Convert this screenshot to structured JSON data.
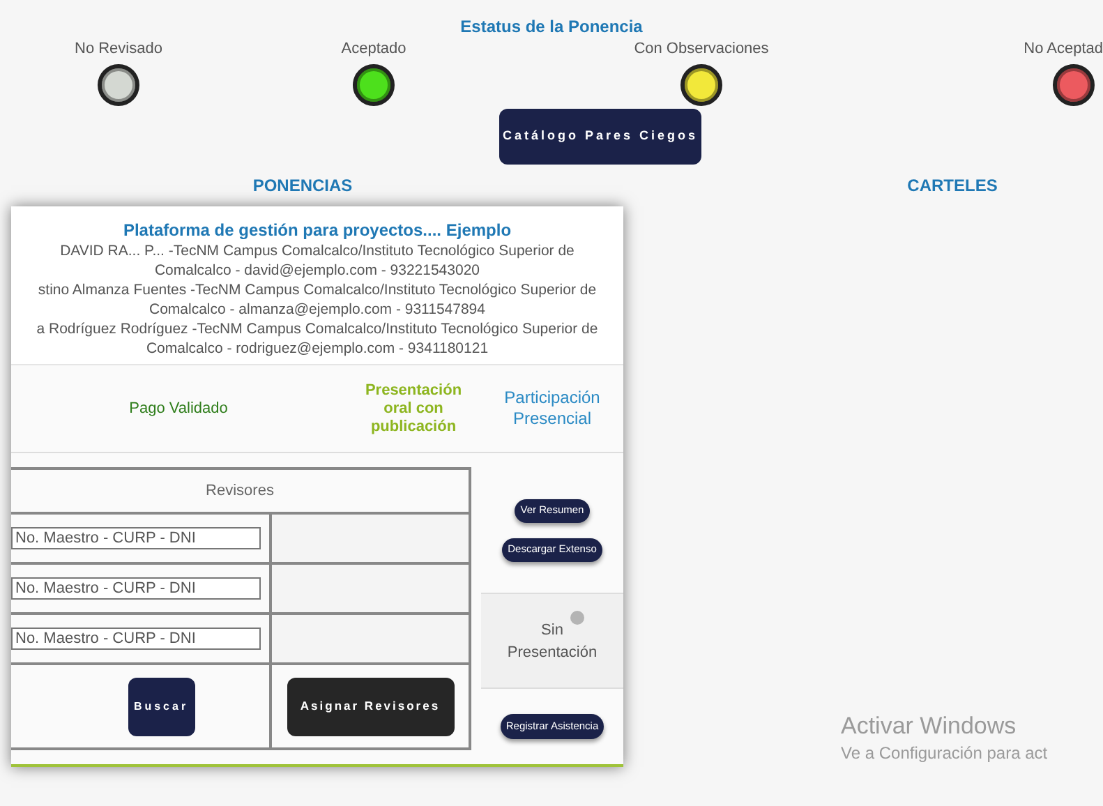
{
  "status_legend": {
    "title": "Estatus de la Ponencia",
    "items": [
      {
        "label": "No Revisado",
        "color": "#d4d8d2"
      },
      {
        "label": "Aceptado",
        "color": "#4de01c"
      },
      {
        "label": "Con Observaciones",
        "color": "#f2e83a"
      },
      {
        "label": "No Aceptad",
        "color": "#ec5a5f"
      }
    ]
  },
  "catalog_button": "Catálogo Pares Ciegos",
  "sections": [
    "PONENCIAS",
    "CARTELES"
  ],
  "card": {
    "title": "Plataforma de gestión para proyectos.... Ejemplo",
    "authors": [
      "DAVID RA... P... -TecNM Campus Comalcalco/Instituto Tecnológico Superior de Comalcalco - david@ejemplo.com - 93221543020",
      "stino Almanza Fuentes -TecNM Campus Comalcalco/Instituto Tecnológico Superior de Comalcalco - almanza@ejemplo.com - 9311547894",
      "a Rodríguez Rodríguez -TecNM Campus Comalcalco/Instituto Tecnológico Superior de Comalcalco - rodriguez@ejemplo.com - 9341180121"
    ],
    "payment": "Pago Validado",
    "presentation_type": "Presentación oral con publicación",
    "participation": "Participación Presencial",
    "reviewers": {
      "title": "Revisores",
      "rows": [
        {
          "placeholder": "No. Maestro - CURP - DNI"
        },
        {
          "placeholder": "No. Maestro - CURP - DNI"
        },
        {
          "placeholder": "No. Maestro - CURP - DNI"
        }
      ],
      "search_button": "Buscar",
      "assign_button": "Asignar Revisores"
    },
    "actions": [
      "Ver Resumen",
      "Descargar Extenso"
    ],
    "attendance": {
      "label": "Sin Presentación",
      "color": "#b4b4b4"
    },
    "register_button": "Registrar Asistencia"
  },
  "windows_notice": {
    "title": "Activar Windows",
    "text": "Ve a Configuración para act"
  }
}
